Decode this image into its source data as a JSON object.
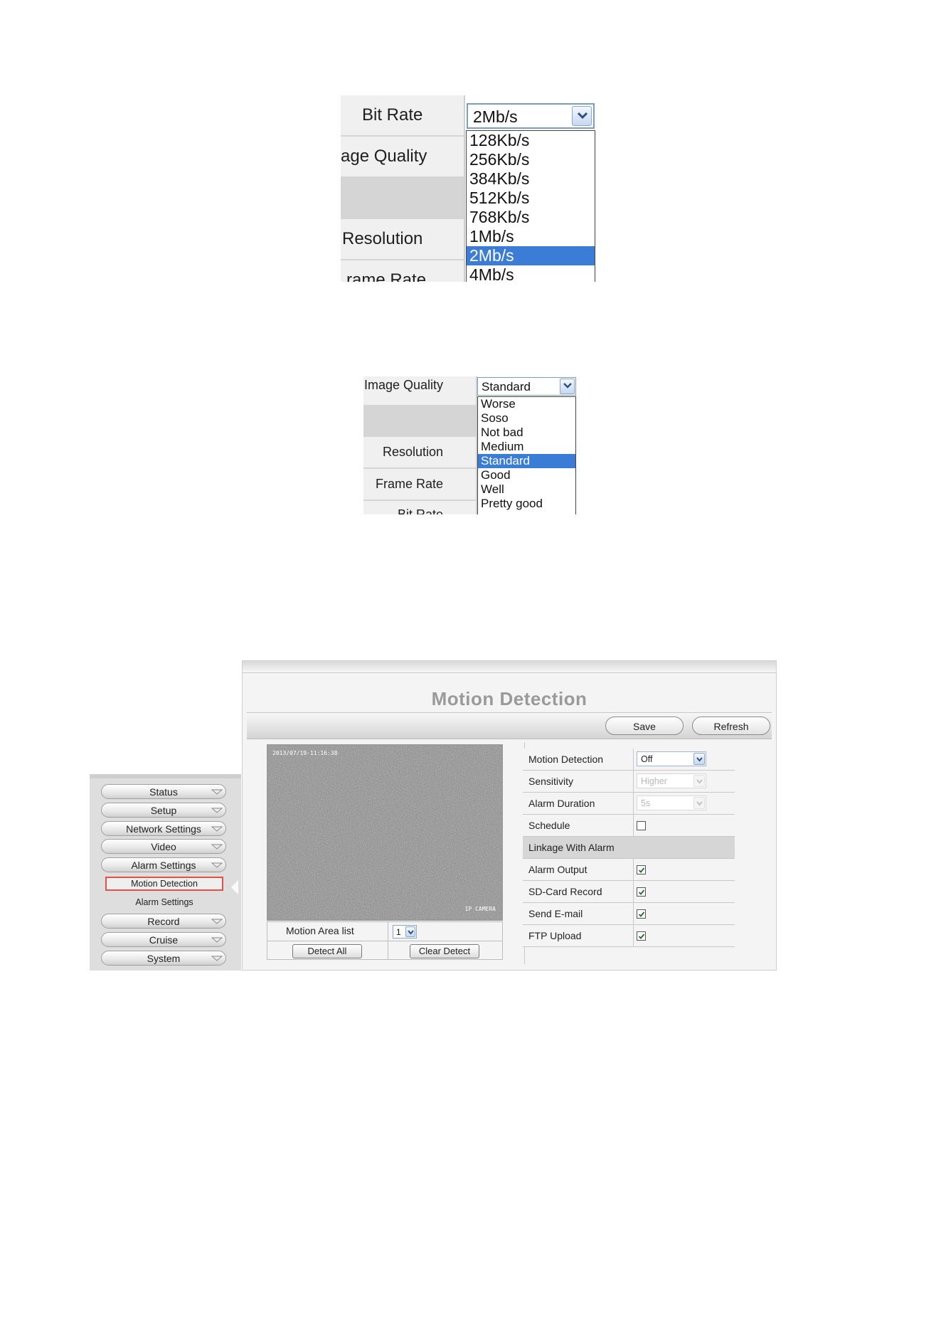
{
  "bitrate_screen": {
    "labels": [
      "Bit Rate",
      "age Quality",
      "Resolution",
      "rame Rate"
    ],
    "selected": "2Mb/s",
    "options": [
      "128Kb/s",
      "256Kb/s",
      "384Kb/s",
      "512Kb/s",
      "768Kb/s",
      "1Mb/s",
      "2Mb/s",
      "4Mb/s"
    ],
    "highlighted": "2Mb/s"
  },
  "quality_screen": {
    "labels": [
      "Image Quality",
      "Resolution",
      "Frame Rate",
      "Bit Rate"
    ],
    "selected": "Standard",
    "options": [
      "Worse",
      "Soso",
      "Not bad",
      "Medium",
      "Standard",
      "Good",
      "Well",
      "Pretty good"
    ],
    "highlighted": "Standard"
  },
  "motion_screen": {
    "title": "Motion Detection",
    "toolbar": {
      "save_label": "Save",
      "refresh_label": "Refresh"
    },
    "sidebar": {
      "items": [
        "Status",
        "Setup",
        "Network Settings",
        "Video",
        "Alarm Settings"
      ],
      "subitems": [
        "Motion Detection",
        "Alarm Settings"
      ],
      "items_after": [
        "Record",
        "Cruise",
        "System"
      ]
    },
    "video": {
      "timestamp": "2013/07/19-11:16:38",
      "camera_label": "IP CAMERA"
    },
    "area": {
      "label": "Motion Area list",
      "value": "1",
      "detect_all": "Detect All",
      "clear_detect": "Clear Detect"
    },
    "settings": [
      {
        "label": "Motion Detection",
        "type": "select",
        "value": "Off",
        "disabled": false
      },
      {
        "label": "Sensitivity",
        "type": "select",
        "value": "Higher",
        "disabled": true
      },
      {
        "label": "Alarm Duration",
        "type": "select",
        "value": "5s",
        "disabled": true
      },
      {
        "label": "Schedule",
        "type": "checkbox",
        "checked": false
      },
      {
        "label": "Linkage With Alarm",
        "type": "header"
      },
      {
        "label": "Alarm Output",
        "type": "checkbox",
        "checked": true
      },
      {
        "label": "SD-Card Record",
        "type": "checkbox",
        "checked": true
      },
      {
        "label": "Send E-mail",
        "type": "checkbox",
        "checked": true
      },
      {
        "label": "FTP Upload",
        "type": "checkbox",
        "checked": true
      }
    ],
    "colors": {
      "highlight": "#3b7cd6",
      "title": "#9a9a9a",
      "active_outline": "#e2504a"
    }
  }
}
